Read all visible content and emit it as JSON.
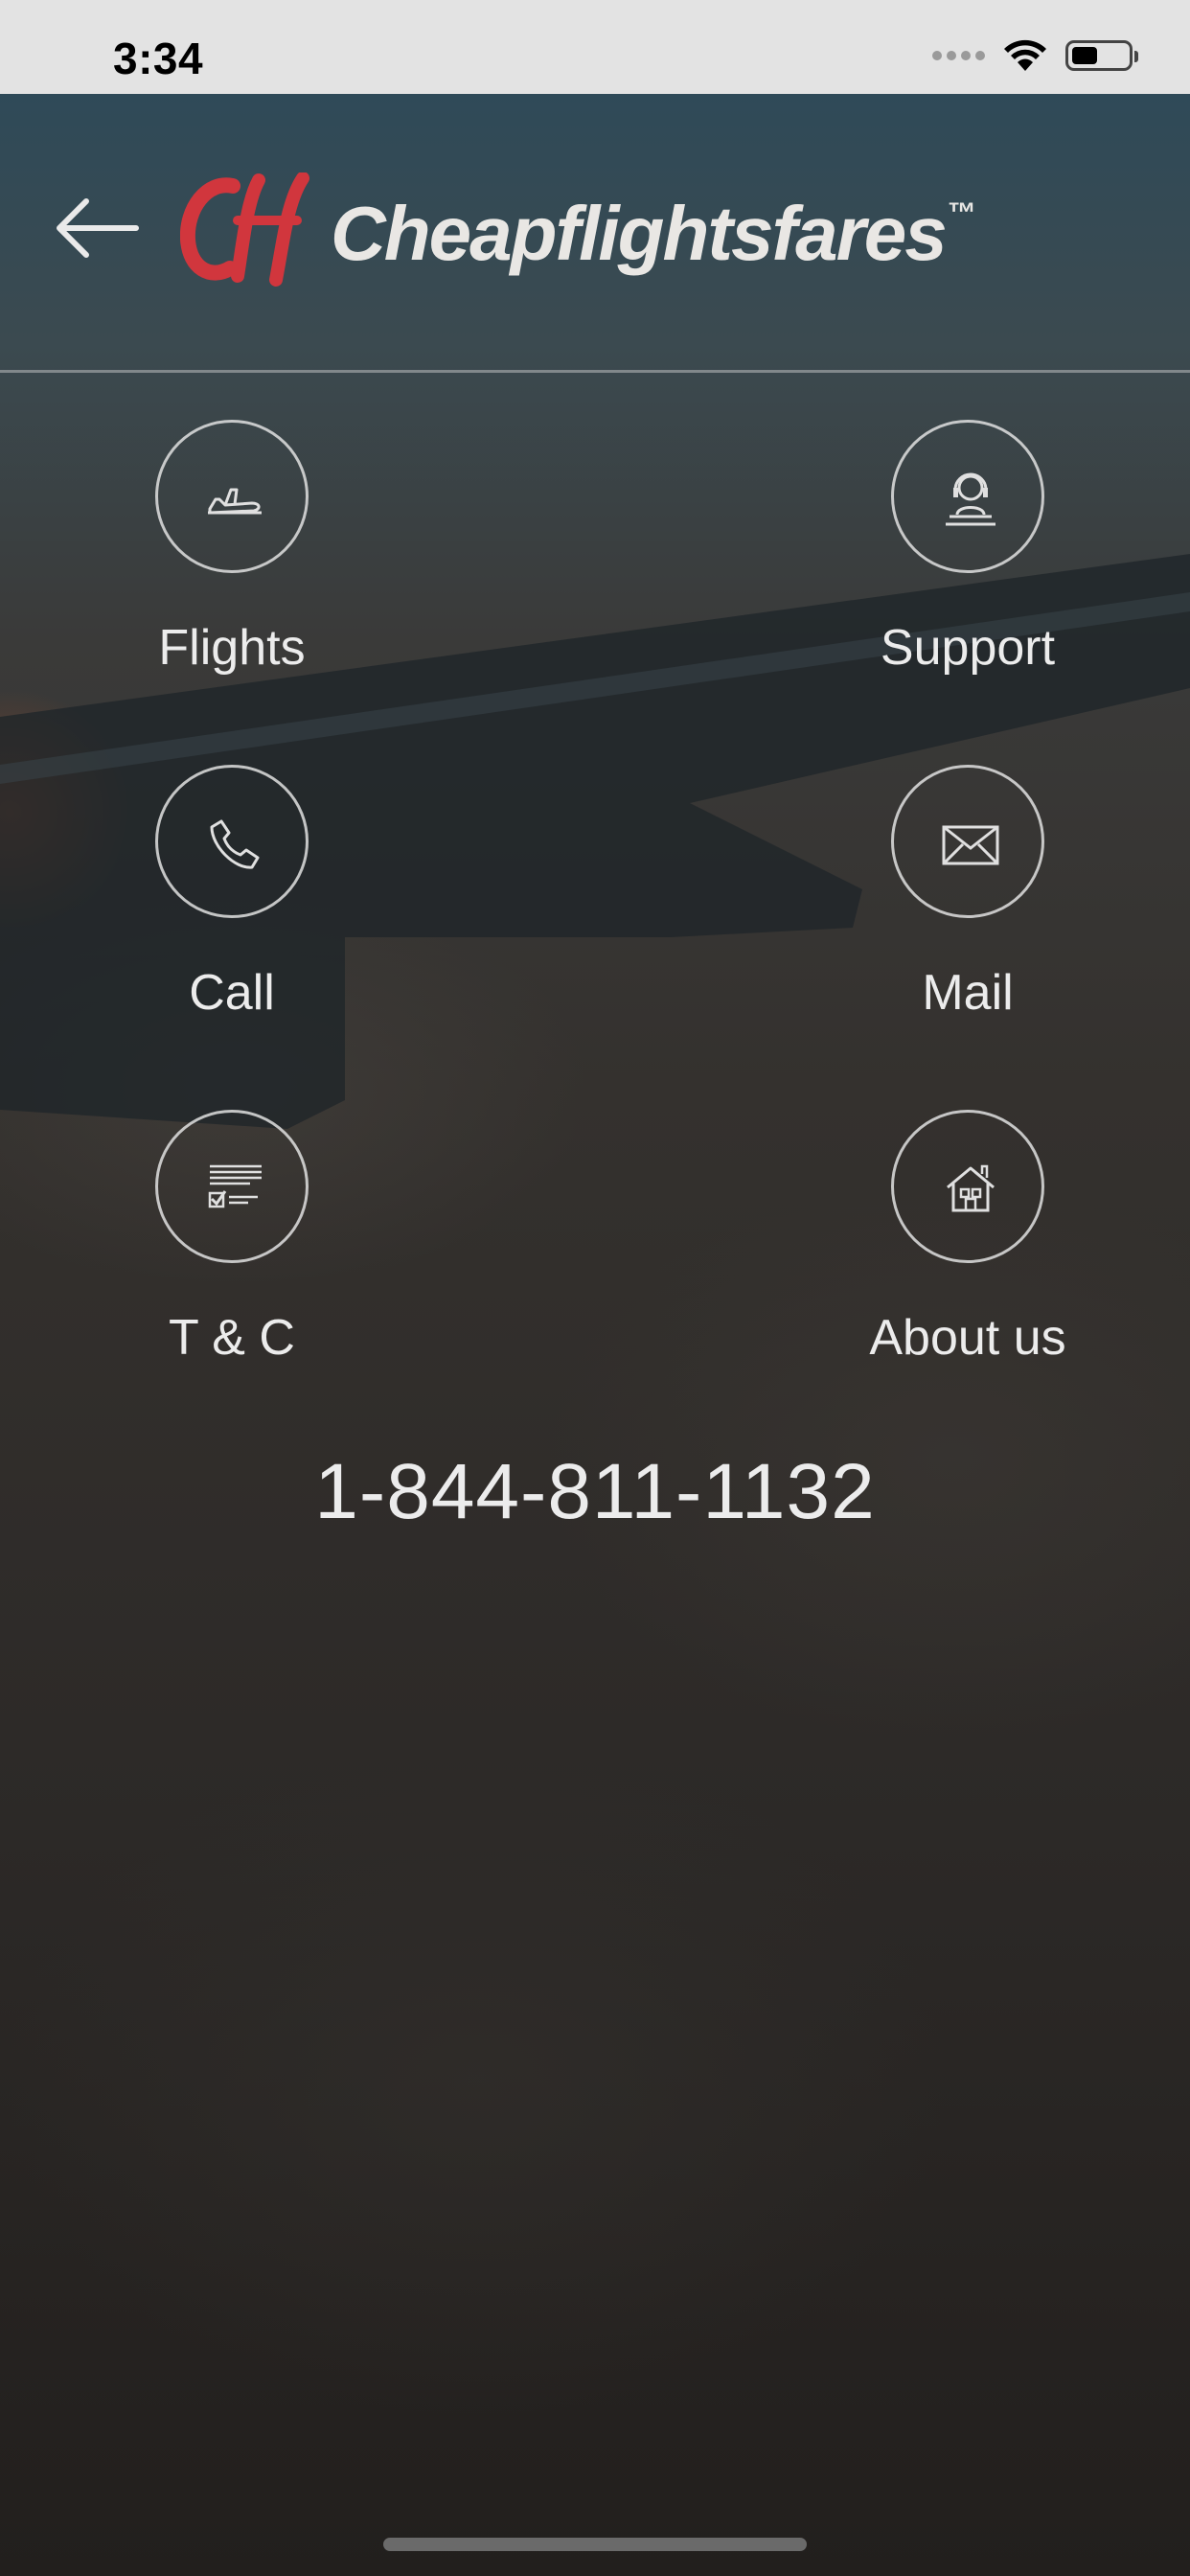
{
  "status_bar": {
    "time": "3:34"
  },
  "header": {
    "brand_name": "Cheapflightsfares",
    "trademark": "™",
    "logo_letters": "cff",
    "back_icon": "back-arrow-icon"
  },
  "menu": {
    "items": [
      {
        "label": "Flights",
        "icon": "airplane-icon"
      },
      {
        "label": "Support",
        "icon": "headset-agent-icon"
      },
      {
        "label": "Call",
        "icon": "phone-icon"
      },
      {
        "label": "Mail",
        "icon": "envelope-icon"
      },
      {
        "label": "T & C",
        "icon": "document-checklist-icon"
      },
      {
        "label": "About us",
        "icon": "house-icon"
      }
    ]
  },
  "contact": {
    "phone": "1-844-811-1132"
  },
  "colors": {
    "brand_red": "#d1363d",
    "text": "#ececec",
    "status_bar_bg": "#e3e3e3"
  }
}
